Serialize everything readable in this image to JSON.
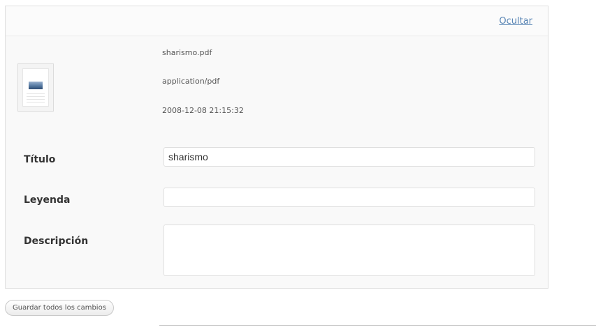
{
  "header": {
    "hide_link": "Ocultar"
  },
  "file": {
    "name": "sharismo.pdf",
    "mime_type": "application/pdf",
    "date": "2008-12-08 21:15:32"
  },
  "form": {
    "title_label": "Título",
    "title_value": "sharismo",
    "caption_label": "Leyenda",
    "caption_value": "",
    "description_label": "Descripción",
    "description_value": ""
  },
  "footer": {
    "save_all_label": "Guardar todos los cambios"
  }
}
